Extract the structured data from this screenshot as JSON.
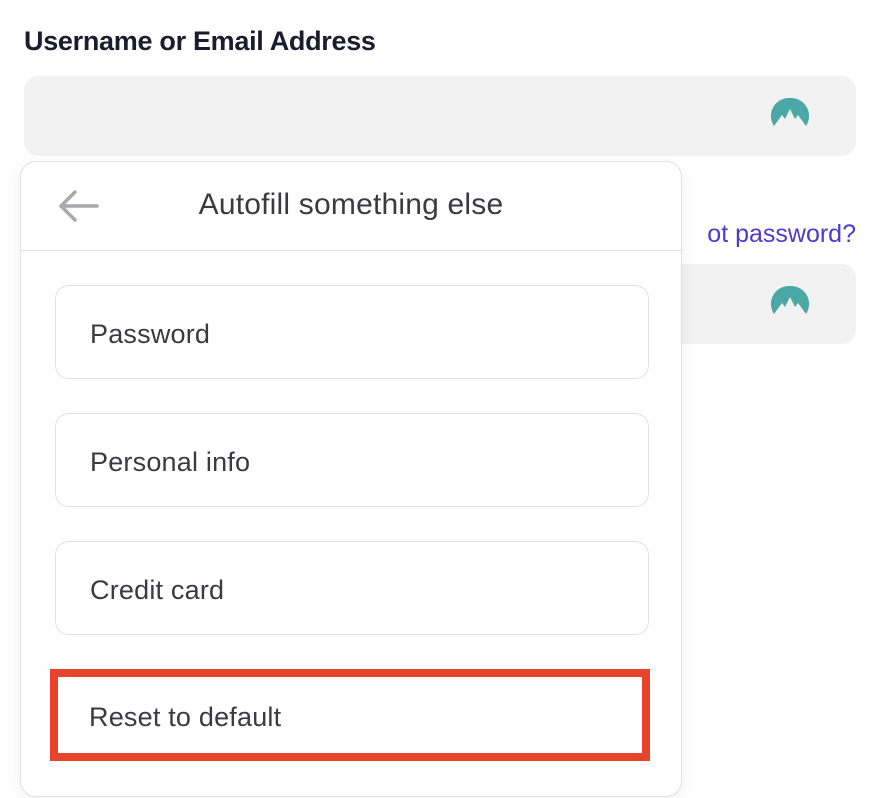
{
  "form": {
    "username_label": "Username or Email Address",
    "forgot_password_link": "ot password?"
  },
  "popup": {
    "title": "Autofill something else",
    "back_icon": "arrow-left-icon",
    "options": [
      {
        "label": "Password"
      },
      {
        "label": "Personal info"
      },
      {
        "label": "Credit card"
      }
    ],
    "reset_label": "Reset to default",
    "highlight_color": "#e8442b"
  },
  "colors": {
    "nordpass_icon": "#4aa8a6",
    "link": "#4b3bcf",
    "input_bg": "#f2f2f2"
  }
}
